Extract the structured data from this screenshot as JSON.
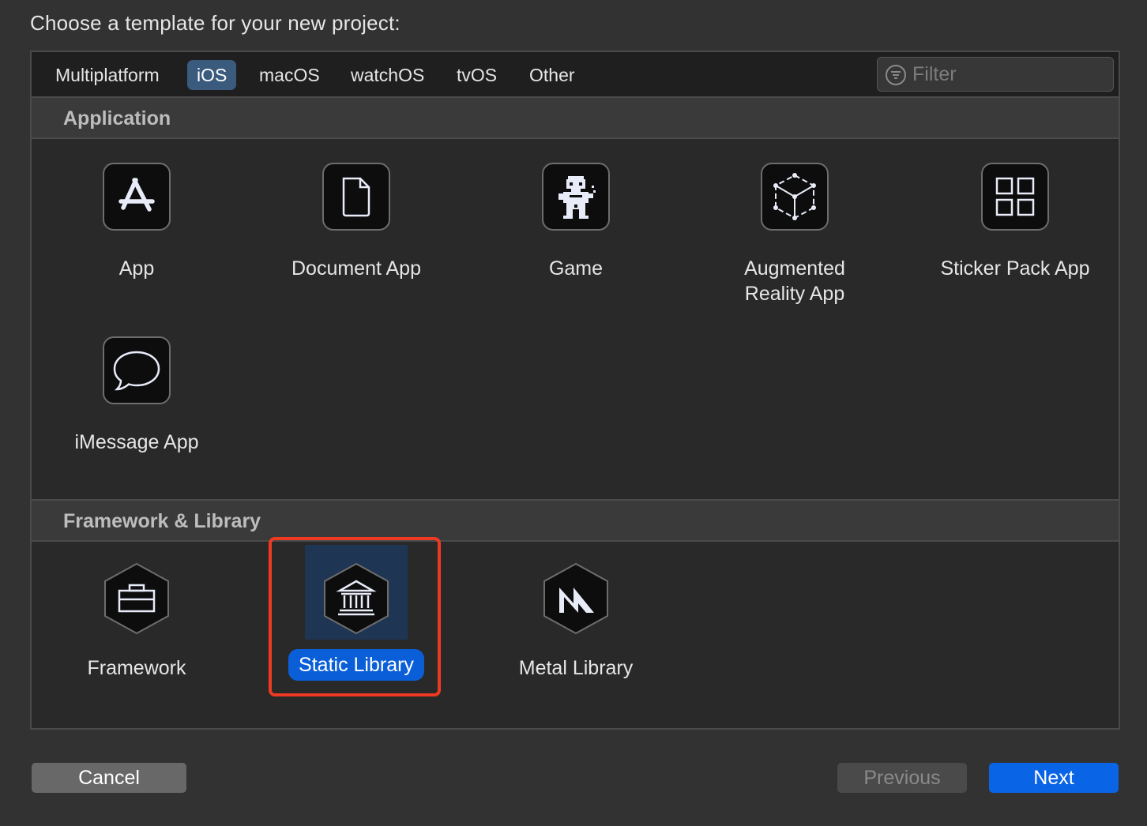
{
  "dialog": {
    "title": "Choose a template for your new project:"
  },
  "tabs": [
    {
      "label": "Multiplatform",
      "active": false
    },
    {
      "label": "iOS",
      "active": true
    },
    {
      "label": "macOS",
      "active": false
    },
    {
      "label": "watchOS",
      "active": false
    },
    {
      "label": "tvOS",
      "active": false
    },
    {
      "label": "Other",
      "active": false
    }
  ],
  "filter": {
    "placeholder": "Filter",
    "value": "",
    "icon": "filter-icon"
  },
  "sections": [
    {
      "title": "Application",
      "templates": [
        {
          "label": "App",
          "icon": "app-store-icon"
        },
        {
          "label": "Document App",
          "icon": "document-icon"
        },
        {
          "label": "Game",
          "icon": "game-character-icon"
        },
        {
          "label": "Augmented Reality App",
          "label_lines": [
            "Augmented",
            "Reality App"
          ],
          "icon": "ar-cube-icon"
        },
        {
          "label": "Sticker Pack App",
          "icon": "grid-icon"
        },
        {
          "label": "iMessage App",
          "icon": "speech-bubble-icon"
        }
      ]
    },
    {
      "title": "Framework & Library",
      "templates": [
        {
          "label": "Framework",
          "icon": "toolbox-hexagon-icon"
        },
        {
          "label": "Static Library",
          "icon": "library-building-hexagon-icon",
          "selected": true
        },
        {
          "label": "Metal Library",
          "icon": "metal-hexagon-icon"
        }
      ]
    }
  ],
  "buttons": {
    "cancel": "Cancel",
    "previous": "Previous",
    "next": "Next"
  },
  "colors": {
    "selection": "#0a5fd8",
    "highlight_outline": "#ef3a23",
    "active_tab": "#3b5b7e",
    "next_button": "#0a64e6"
  }
}
